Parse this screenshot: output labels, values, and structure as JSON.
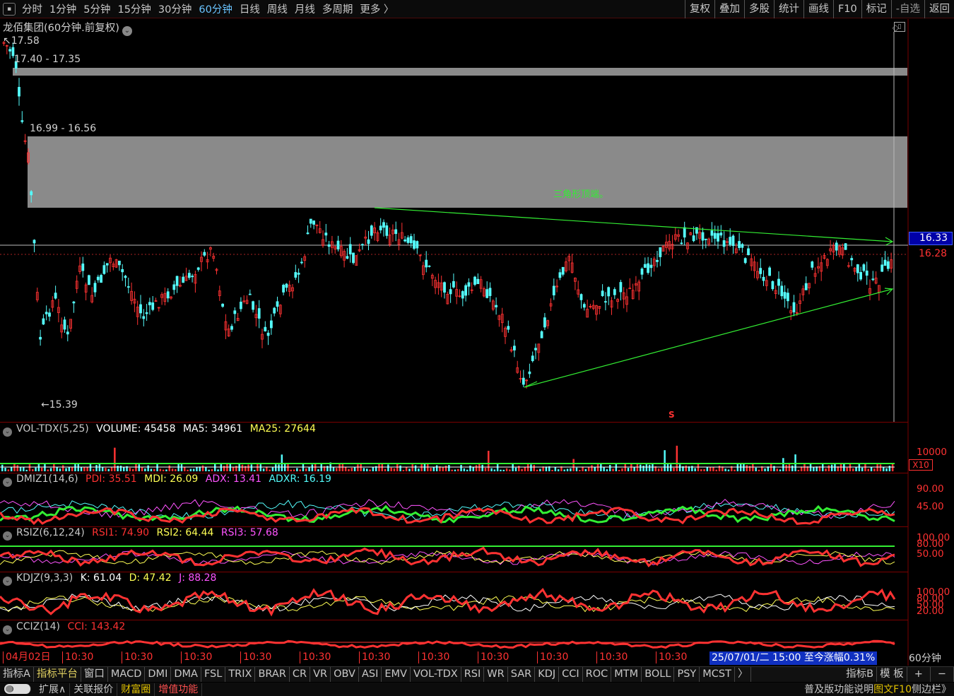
{
  "toolbar": {
    "periods": [
      "分时",
      "1分钟",
      "5分钟",
      "15分钟",
      "30分钟",
      "60分钟",
      "日线",
      "周线",
      "月线",
      "多周期",
      "更多 〉"
    ],
    "active_period": "60分钟",
    "right_items": [
      "复权",
      "叠加",
      "多股",
      "统计",
      "画线",
      "F10",
      "标记",
      "-自选",
      "返回"
    ]
  },
  "chart_title": "龙佰集团(60分钟.前复权)",
  "main_chart": {
    "price_labels": {
      "high": "17.58",
      "low": "15.39",
      "zone1": "17.40 - 17.35",
      "zone2": "16.99 - 16.56",
      "current": "16.33",
      "last": "16.28"
    },
    "annotation": "三角形顶端。",
    "marker": "S"
  },
  "indicators": {
    "vol": {
      "name": "VOL-TDX(5,25)",
      "volume_label": "VOLUME: 45458",
      "ma5_label": "MA5: 34961",
      "ma25_label": "MA25: 27644",
      "scale": "10000",
      "unit": "X10"
    },
    "dmi": {
      "name": "DMIZ1(14,6)",
      "pdi": "PDI: 35.51",
      "mdi": "MDI: 26.09",
      "adx": "ADX: 13.41",
      "adxr": "ADXR: 16.19",
      "levels": [
        "90.00",
        "45.00"
      ]
    },
    "rsi": {
      "name": "RSIZ(6,12,24)",
      "rsi1": "RSI1: 74.90",
      "rsi2": "RSI2: 64.44",
      "rsi3": "RSI3: 57.68",
      "levels": [
        "100.00",
        "80.00",
        "50.00"
      ]
    },
    "kdj": {
      "name": "KDJZ(9,3,3)",
      "k": "K: 61.04",
      "d": "D: 47.42",
      "j": "J: 88.28",
      "levels": [
        "100.00",
        "80.00",
        "50.00",
        "20.00"
      ]
    },
    "cci": {
      "name": "CCIZ(14)",
      "cci": "CCI: 143.42"
    }
  },
  "time_axis": {
    "labels": [
      "04月02日",
      "10:30",
      "10:30",
      "10:30",
      "10:30",
      "10:30",
      "10:30",
      "10:30",
      "10:30",
      "10:30",
      "10:30",
      "10:30"
    ],
    "cursor": "25/07/01/二 15:00",
    "change": "至今涨幅0.31%",
    "period": "60分钟"
  },
  "indicator_tabs": [
    "指标A",
    "指标平台",
    "窗口",
    "MACD",
    "DMI",
    "DMA",
    "FSL",
    "TRIX",
    "BRAR",
    "CR",
    "VR",
    "OBV",
    "ASI",
    "EMV",
    "VOL-TDX",
    "RSI",
    "WR",
    "SAR",
    "KDJ",
    "CCI",
    "ROC",
    "MTM",
    "BOLL",
    "PSY",
    "MCST",
    "〉",
    "指标B",
    "模 板",
    "+",
    "−"
  ],
  "status": {
    "toggle": "",
    "items": [
      "扩展∧",
      "关联报价",
      "财富圈",
      "增值功能"
    ],
    "right": "普及版功能说明",
    "right2": "图文F10",
    "right3": "侧边栏》"
  },
  "colors": {
    "up": "#ff3232",
    "down": "#54fcfc",
    "green": "#33ee33",
    "yellow": "#ffff54",
    "magenta": "#ff54ff",
    "white": "#ffffff",
    "zone": "#808080"
  }
}
